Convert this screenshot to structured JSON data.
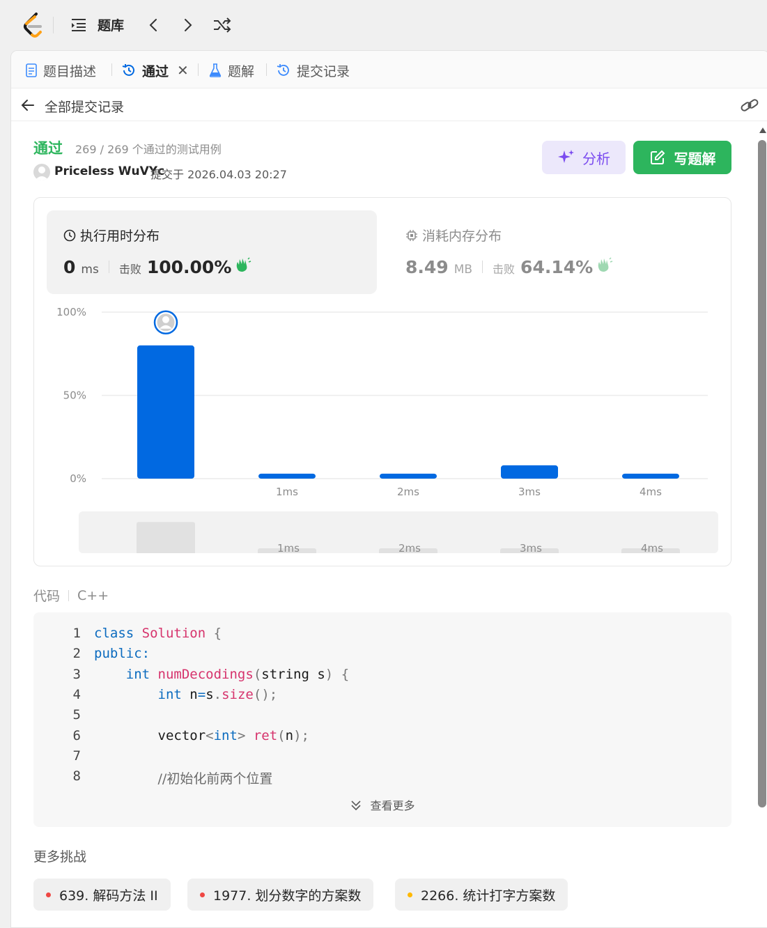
{
  "topbar": {
    "title": "题库"
  },
  "tabs": [
    {
      "label": "题目描述"
    },
    {
      "label": "通过"
    },
    {
      "label": "题解"
    },
    {
      "label": "提交记录"
    }
  ],
  "subheader": {
    "title": "全部提交记录"
  },
  "submission": {
    "status": "通过",
    "testcases": "269 / 269 个通过的测试用例",
    "username": "Priceless WuVYc",
    "submitted_at": "提交于 2026.04.03 20:27"
  },
  "buttons": {
    "analyze": "分析",
    "write_solution": "写题解"
  },
  "runtime": {
    "title": "执行用时分布",
    "value": "0",
    "unit": "ms",
    "beat_label": "击败",
    "beat_pct": "100.00%"
  },
  "memory": {
    "title": "消耗内存分布",
    "value": "8.49",
    "unit": "MB",
    "beat_label": "击败",
    "beat_pct": "64.14%"
  },
  "chart_data": {
    "type": "bar",
    "categories": [
      "",
      "1ms",
      "2ms",
      "3ms",
      "4ms"
    ],
    "values": [
      80,
      3,
      3,
      8,
      3
    ],
    "y_ticks": [
      "100%",
      "50%",
      "0%"
    ],
    "ylim": [
      0,
      100
    ],
    "highlight_index": 0,
    "bar_color": "#0169e1"
  },
  "minimap": {
    "labels": [
      "1ms",
      "2ms",
      "3ms",
      "4ms"
    ]
  },
  "code": {
    "label": "代码",
    "language": "C++",
    "more_label": "查看更多",
    "lines": [
      {
        "no": "1",
        "text": "class Solution {"
      },
      {
        "no": "2",
        "text": "public:"
      },
      {
        "no": "3",
        "text": "    int numDecodings(string s) {"
      },
      {
        "no": "4",
        "text": "        int n=s.size();"
      },
      {
        "no": "5",
        "text": ""
      },
      {
        "no": "6",
        "text": "        vector<int> ret(n);"
      },
      {
        "no": "7",
        "text": ""
      },
      {
        "no": "8",
        "text": "        //初始化前两个位置"
      }
    ]
  },
  "more_challenges": {
    "label": "更多挑战",
    "items": [
      {
        "label": "639. 解码方法 II",
        "dot_color": "#ef4743"
      },
      {
        "label": "1977. 划分数字的方案数",
        "dot_color": "#ef4743"
      },
      {
        "label": "2266. 统计打字方案数",
        "dot_color": "#ffb800"
      }
    ]
  }
}
